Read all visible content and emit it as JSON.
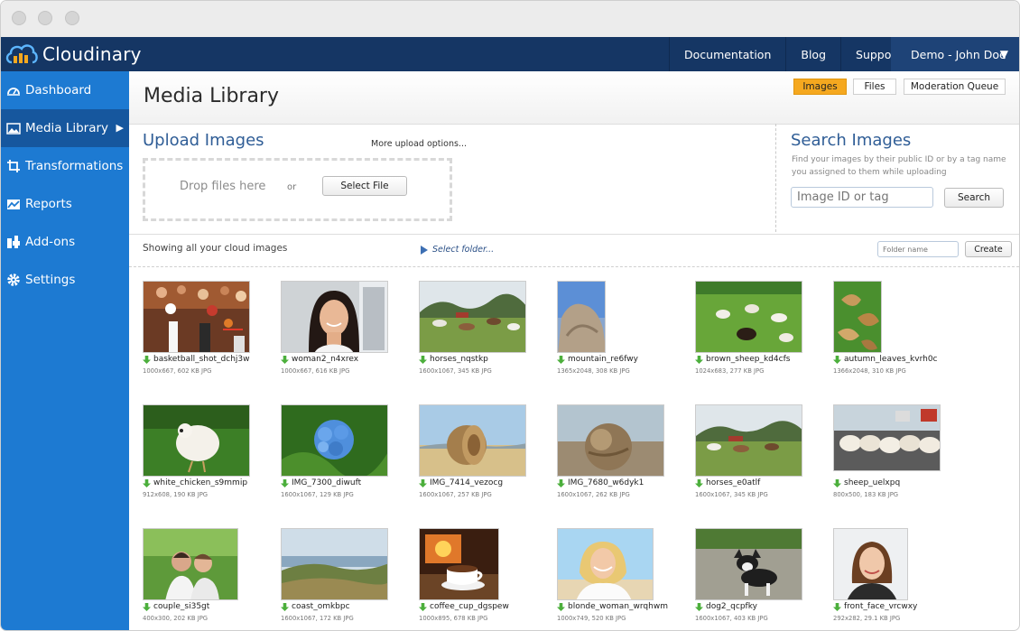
{
  "app": {
    "brand": "Cloudinary"
  },
  "nav": {
    "items": [
      "Documentation",
      "Blog",
      "Support"
    ],
    "user": "Demo - John Doe"
  },
  "sidebar": {
    "items": [
      {
        "label": "Dashboard",
        "icon": "dashboard-icon"
      },
      {
        "label": "Media Library",
        "icon": "image-icon",
        "active": true
      },
      {
        "label": "Transformations",
        "icon": "crop-icon"
      },
      {
        "label": "Reports",
        "icon": "reports-icon"
      },
      {
        "label": "Add-ons",
        "icon": "addons-icon"
      },
      {
        "label": "Settings",
        "icon": "gear-icon"
      }
    ]
  },
  "page": {
    "title": "Media Library"
  },
  "tabs": [
    {
      "label": "Images",
      "active": true
    },
    {
      "label": "Files"
    },
    {
      "label": "Moderation Queue"
    }
  ],
  "upload": {
    "title": "Upload Images",
    "more_link": "More upload options...",
    "drop_text": "Drop files here",
    "or_text": "or",
    "select_button": "Select File"
  },
  "search": {
    "title": "Search Images",
    "description": "Find your images by their public ID or by a tag name you assigned to them while uploading",
    "placeholder": "Image ID or tag",
    "button": "Search"
  },
  "listing": {
    "showing_text": "Showing all your cloud images",
    "folder_link": "Select folder...",
    "folder_placeholder": "Folder name",
    "create_button": "Create"
  },
  "colors": {
    "topbar": "#153664",
    "sidebar": "#1d7ad2",
    "sidebar_active": "#16579e",
    "active_tab": "#f5a81f",
    "heading": "#2f5d96"
  },
  "images": [
    {
      "name": "basketball_shot_dchj3w",
      "meta": "1000x667, 602 KB JPG"
    },
    {
      "name": "woman2_n4xrex",
      "meta": "1000x667, 616 KB JPG"
    },
    {
      "name": "horses_nqstkp",
      "meta": "1600x1067, 345 KB JPG"
    },
    {
      "name": "mountain_re6fwy",
      "meta": "1365x2048, 308 KB JPG"
    },
    {
      "name": "brown_sheep_kd4cfs",
      "meta": "1024x683, 277 KB JPG"
    },
    {
      "name": "autumn_leaves_kvrh0c",
      "meta": "1366x2048, 310 KB JPG"
    },
    {
      "name": "white_chicken_s9mmip",
      "meta": "912x608, 190 KB JPG"
    },
    {
      "name": "IMG_7300_diwuft",
      "meta": "1600x1067, 129 KB JPG"
    },
    {
      "name": "IMG_7414_vezocg",
      "meta": "1600x1067, 257 KB JPG"
    },
    {
      "name": "IMG_7680_w6dyk1",
      "meta": "1600x1067, 262 KB JPG"
    },
    {
      "name": "horses_e0atlf",
      "meta": "1600x1067, 345 KB JPG"
    },
    {
      "name": "sheep_uelxpq",
      "meta": "800x500, 183 KB JPG"
    },
    {
      "name": "couple_si35gt",
      "meta": "400x300, 202 KB JPG"
    },
    {
      "name": "coast_omkbpc",
      "meta": "1600x1067, 172 KB JPG"
    },
    {
      "name": "coffee_cup_dgspew",
      "meta": "1000x895, 678 KB JPG"
    },
    {
      "name": "blonde_woman_wrqhwm",
      "meta": "1000x749, 520 KB JPG"
    },
    {
      "name": "dog2_qcpfky",
      "meta": "1600x1067, 403 KB JPG"
    },
    {
      "name": "front_face_vrcwxy",
      "meta": "292x282, 29.1 KB JPG"
    }
  ]
}
